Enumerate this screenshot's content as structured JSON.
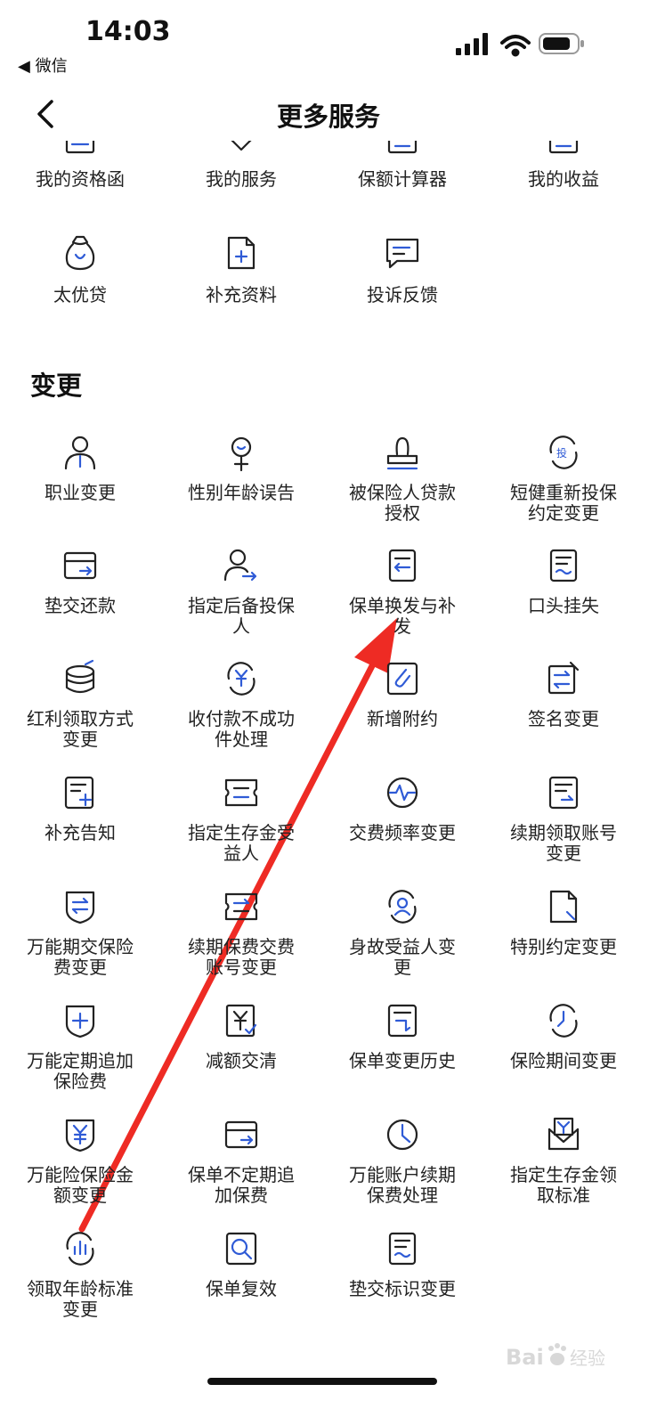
{
  "status_bar": {
    "time": "14:03",
    "back_app": "◀ 微信"
  },
  "header": {
    "title": "更多服务"
  },
  "top_row": [
    {
      "label": "我的资格函",
      "icon": "certificate-icon"
    },
    {
      "label": "我的服务",
      "icon": "service-icon"
    },
    {
      "label": "保额计算器",
      "icon": "calculator-icon"
    },
    {
      "label": "我的收益",
      "icon": "income-icon"
    }
  ],
  "second_row": [
    {
      "label": "太优贷",
      "icon": "money-bag-icon"
    },
    {
      "label": "补充资料",
      "icon": "add-document-icon"
    },
    {
      "label": "投诉反馈",
      "icon": "feedback-chat-icon"
    }
  ],
  "section": {
    "title": "变更",
    "items": [
      {
        "label": "职业变更",
        "icon": "person-tie-icon"
      },
      {
        "label": "性别年龄误告",
        "icon": "gender-icon"
      },
      {
        "label": "被保险人贷款授权",
        "icon": "stamp-icon"
      },
      {
        "label": "短健重新投保约定变更",
        "icon": "reinsure-icon"
      },
      {
        "label": "垫交还款",
        "icon": "card-arrow-icon"
      },
      {
        "label": "指定后备投保人",
        "icon": "person-arrow-icon"
      },
      {
        "label": "保单换发与补发",
        "icon": "document-exchange-icon"
      },
      {
        "label": "口头挂失",
        "icon": "document-wave-icon"
      },
      {
        "label": "红利领取方式变更",
        "icon": "coins-stack-icon"
      },
      {
        "label": "收付款不成功件处理",
        "icon": "yuan-refresh-icon"
      },
      {
        "label": "新增附约",
        "icon": "paperclip-icon"
      },
      {
        "label": "签名变更",
        "icon": "edit-swap-icon"
      },
      {
        "label": "补充告知",
        "icon": "document-plus-icon"
      },
      {
        "label": "指定生存金受益人",
        "icon": "ticket-icon"
      },
      {
        "label": "交费频率变更",
        "icon": "pulse-icon"
      },
      {
        "label": "续期领取账号变更",
        "icon": "document-list-icon"
      },
      {
        "label": "万能期交保险费变更",
        "icon": "shield-swap-icon"
      },
      {
        "label": "续期保费交费账号变更",
        "icon": "ticket-swap-icon"
      },
      {
        "label": "身故受益人变更",
        "icon": "person-circle-icon"
      },
      {
        "label": "特别约定变更",
        "icon": "document-pen-icon"
      },
      {
        "label": "万能定期追加保险费",
        "icon": "shield-plus-icon"
      },
      {
        "label": "减额交清",
        "icon": "yuan-check-icon"
      },
      {
        "label": "保单变更历史",
        "icon": "document-history-icon"
      },
      {
        "label": "保险期间变更",
        "icon": "clock-refresh-icon"
      },
      {
        "label": "万能险保险金额变更",
        "icon": "shield-yuan-icon"
      },
      {
        "label": "保单不定期追加保费",
        "icon": "card-arrow-icon"
      },
      {
        "label": "万能账户续期保费处理",
        "icon": "clock-icon"
      },
      {
        "label": "指定生存金领取标准",
        "icon": "envelope-yuan-icon"
      },
      {
        "label": "领取年龄标准变更",
        "icon": "chart-refresh-icon"
      },
      {
        "label": "保单复效",
        "icon": "search-document-icon"
      },
      {
        "label": "垫交标识变更",
        "icon": "document-wave-icon"
      }
    ]
  },
  "watermark": "Baidu 经验",
  "colors": {
    "accent": "#2f5bd6",
    "icon_stroke": "#222222",
    "annotation_arrow": "#ee2b24"
  }
}
